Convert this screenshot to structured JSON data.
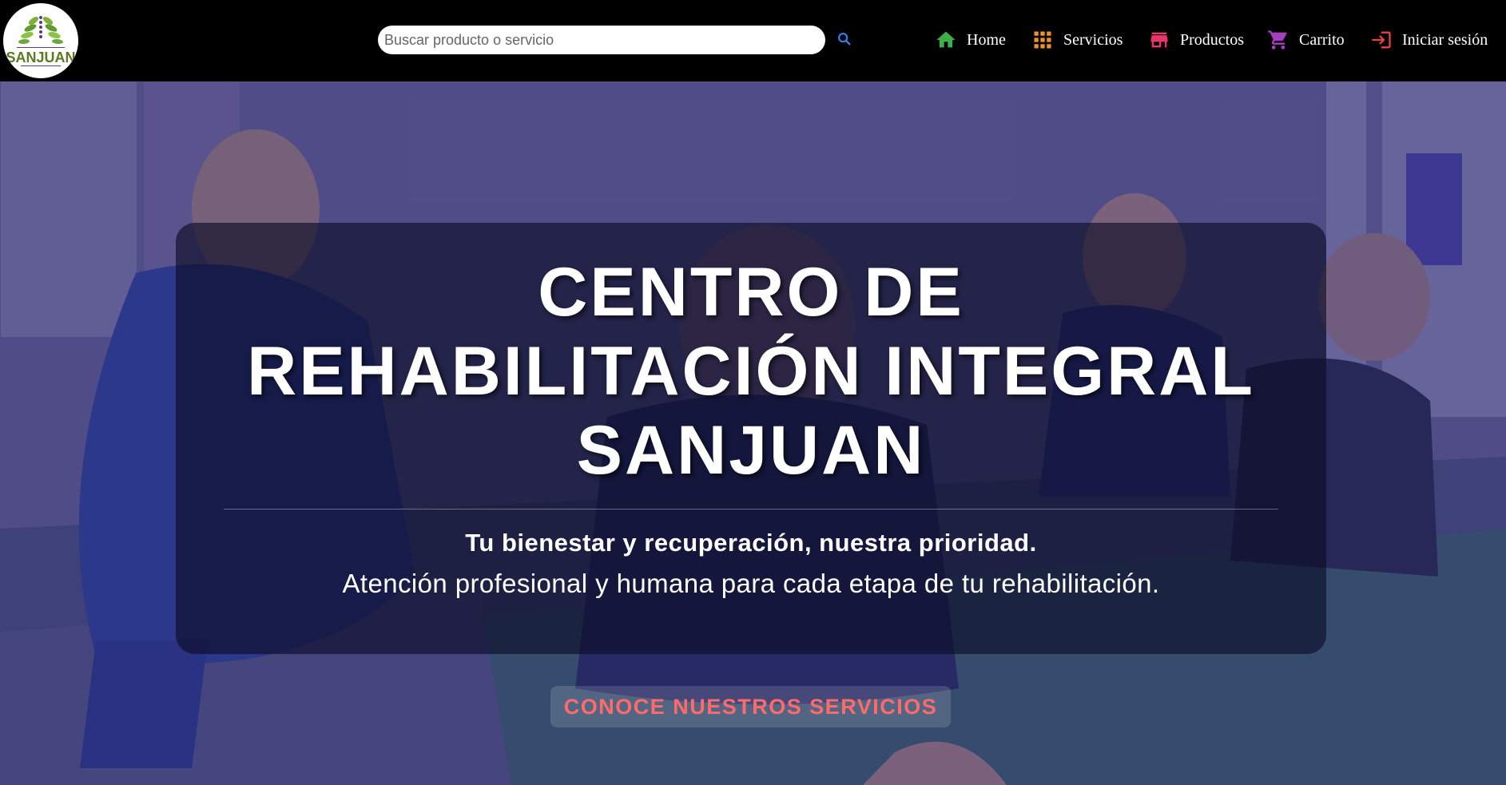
{
  "header": {
    "logo": {
      "brand_text": "SANJUAN",
      "tiny_text": "CENTRO DE REHABILITACIÓN INTEGRAL",
      "icon": "tree-leaves-logo"
    },
    "search": {
      "placeholder": "Buscar producto o servicio",
      "value": "",
      "button_icon": "search-icon"
    },
    "nav": [
      {
        "label": "Home",
        "icon": "home-icon",
        "color": "#3fae49"
      },
      {
        "label": "Servicios",
        "icon": "grid-icon",
        "color": "#f0932b"
      },
      {
        "label": "Productos",
        "icon": "store-icon",
        "color": "#e8336b"
      },
      {
        "label": "Carrito",
        "icon": "cart-icon",
        "color": "#a43fbf"
      },
      {
        "label": "Iniciar sesión",
        "icon": "login-icon",
        "color": "#e84040"
      }
    ]
  },
  "hero": {
    "title_lines": [
      "CENTRO DE",
      "REHABILITACIÓN INTEGRAL",
      "SANJUAN"
    ],
    "tagline": "Tu bienestar y recuperación, nuestra prioridad.",
    "description": "Atención profesional y humana para cada etapa de tu rehabilitación.",
    "cta_label": "CONOCE NUESTROS SERVICIOS",
    "cta_color": "#ff6b6b"
  },
  "colors": {
    "navbar_bg": "#000000",
    "card_bg": "rgba(10,10,35,0.62)",
    "search_icon": "#2f80ed"
  }
}
